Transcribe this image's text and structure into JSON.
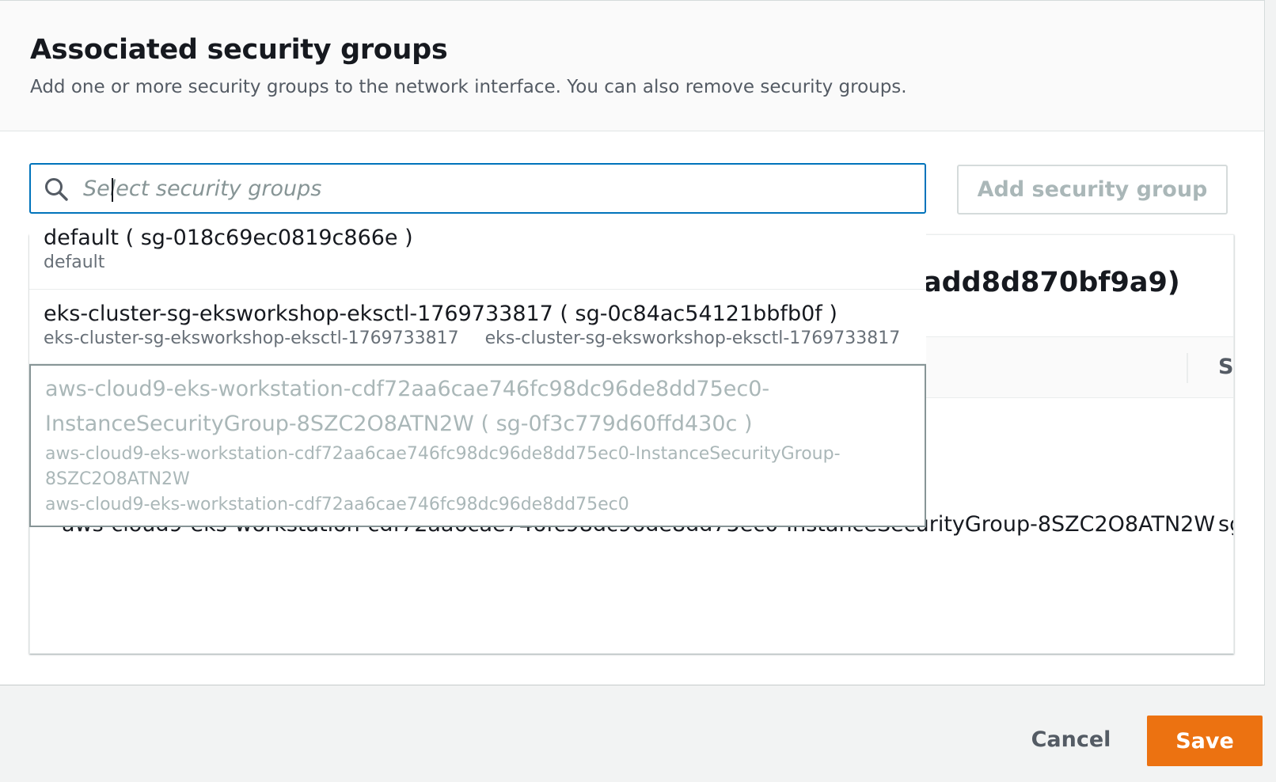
{
  "header": {
    "title": "Associated security groups",
    "subtitle": "Add one or more security groups to the network interface. You can also remove security groups."
  },
  "search": {
    "placeholder": "Select security groups",
    "value": ""
  },
  "add_button_label": "Add security group",
  "dropdown": {
    "options": [
      {
        "label": "default ( sg-018c69ec0819c866e )",
        "description": "default",
        "tags": [],
        "disabled": false
      },
      {
        "label": "eks-cluster-sg-eksworkshop-eksctl-1769733817 ( sg-0c84ac54121bbfb0f )",
        "description": "eks-cluster-sg-eksworkshop-eksctl-1769733817",
        "tags": [
          "eks-cluster-sg-eksworkshop-eksctl-1769733817"
        ],
        "disabled": false
      },
      {
        "label": "aws-cloud9-eks-workstation-cdf72aa6cae746fc98dc96de8dd75ec0-InstanceSecurityGroup-8SZC2O8ATN2W ( sg-0f3c779d60ffd430c )",
        "description": "aws-cloud9-eks-workstation-cdf72aa6cae746fc98dc96de8dd75ec0-InstanceSecurityGroup-8SZC2O8ATN2W",
        "tags": [
          "aws-cloud9-eks-workstation-cdf72aa6cae746fc98dc96de8dd75ec0"
        ],
        "disabled": true
      }
    ]
  },
  "table": {
    "title_visible": "add8d870bf9a9)",
    "column_header_visible": "Se",
    "row": {
      "name": "aws-cloud9-eks-workstation-cdf72aa6cae746fc98dc96de8dd75ec0-InstanceSecurityGroup-8SZC2O8ATN2W",
      "id_visible": "sg"
    }
  },
  "footer": {
    "cancel_label": "Cancel",
    "save_label": "Save"
  },
  "colors": {
    "focus_border": "#0073bb",
    "primary_button": "#ec7211",
    "disabled_text": "#aab7b8"
  },
  "icons": {
    "search": "search-icon"
  }
}
